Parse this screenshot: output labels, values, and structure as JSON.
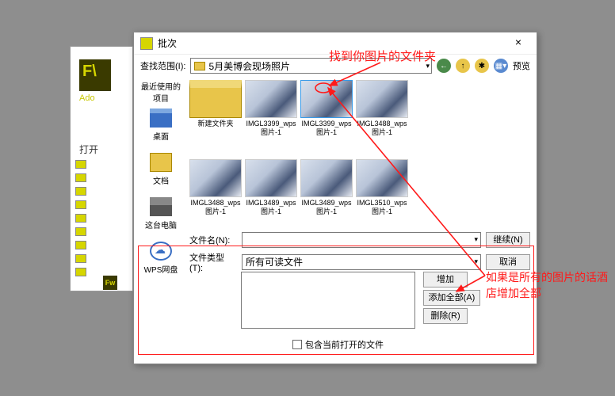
{
  "dialog": {
    "title": "批次",
    "search_label": "查找范围(I):",
    "folder_name": "5月美博会现场照片",
    "preview_label": "预览",
    "recent_label": "最近使用的项目"
  },
  "sidebar": {
    "desktop": "桌面",
    "documents": "文档",
    "thispc": "这台电脑",
    "wps": "WPS网盘"
  },
  "thumbs": [
    {
      "label": "新建文件夹",
      "folder": true
    },
    {
      "label": "IMGL3399_wps图片-1"
    },
    {
      "label": "IMGL3399_wps图片-1",
      "selected": true
    },
    {
      "label": "IMGL3488_wps图片-1"
    },
    {
      "label": "IMGL3488_wps图片-1"
    },
    {
      "label": "IMGL3489_wps图片-1"
    },
    {
      "label": "IMGL3489_wps图片-1"
    },
    {
      "label": "IMGL3510_wps图片-1"
    }
  ],
  "form": {
    "filename_label": "文件名(N):",
    "filetype_label": "文件类型(T):",
    "filetype_value": "所有可读文件"
  },
  "buttons": {
    "continue": "继续(N)",
    "cancel": "取消",
    "add": "增加",
    "add_all": "添加全部(A)",
    "delete": "删除(R)"
  },
  "checkbox": "包含当前打开的文件",
  "open_label": "打开",
  "fw_logo": "F\\",
  "fw_ado": "Ado",
  "fw_small": "Fw",
  "annotations": {
    "a1": "找到你图片的文件夹",
    "a2": "如果是所有的图片的话酒店增加全部"
  }
}
